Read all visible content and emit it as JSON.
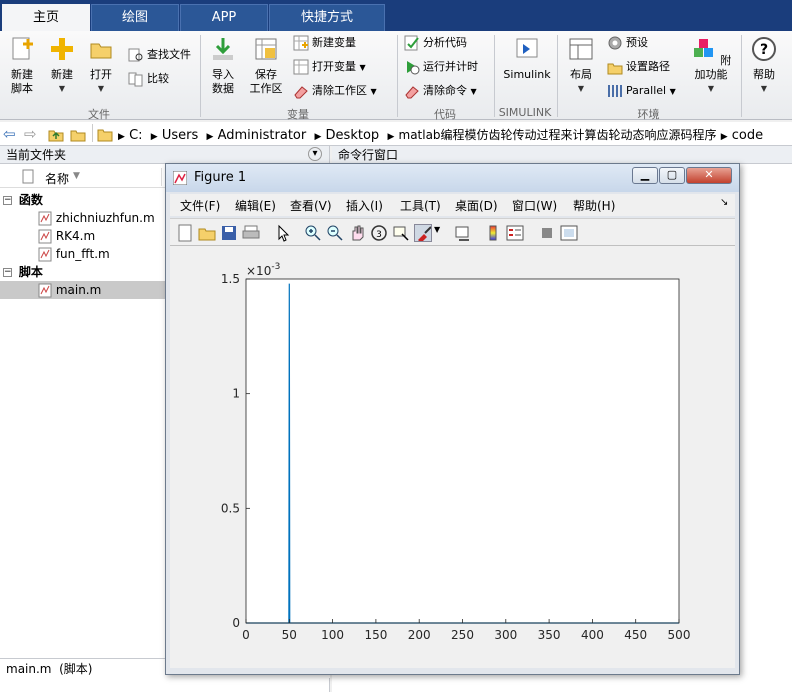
{
  "tabs": [
    {
      "label": "主页",
      "active": true
    },
    {
      "label": "绘图",
      "active": false
    },
    {
      "label": "APP",
      "active": false
    },
    {
      "label": "快捷方式",
      "active": false
    }
  ],
  "ribbon": {
    "file": {
      "new_script": "新建\n脚本",
      "new": "新建",
      "open": "打开",
      "find_files": "查找文件",
      "compare": "比较",
      "group": "文件"
    },
    "variable": {
      "import": "导入\n数据",
      "save_workspace": "保存\n工作区",
      "new_variable": "新建变量",
      "open_variable": "打开变量",
      "clear_workspace": "清除工作区",
      "group": "变量"
    },
    "code": {
      "analyze": "分析代码",
      "run_time": "运行并计时",
      "clear_commands": "清除命令",
      "group": "代码"
    },
    "simulink": {
      "label": "Simulink",
      "group": "SIMULINK"
    },
    "environment": {
      "layout": "布局",
      "preferences": "预设",
      "set_path": "设置路径",
      "parallel": "Parallel",
      "addons": "附加功能",
      "group": "环境"
    },
    "help": {
      "label": "帮助"
    }
  },
  "address": {
    "path": [
      "C:",
      "Users",
      "Administrator",
      "Desktop",
      "matlab编程模仿齿轮传动过程来计算齿轮动态响应源码程序",
      "code"
    ]
  },
  "current_folder": {
    "title": "当前文件夹",
    "column": "名称",
    "groups": [
      {
        "label": "函数",
        "files": [
          "zhichniuzhfun.m",
          "RK4.m",
          "fun_fft.m"
        ]
      },
      {
        "label": "脚本",
        "files": [
          "main.m"
        ]
      }
    ],
    "status": "main.m  (脚本)"
  },
  "command_window": {
    "title": "命令行窗口"
  },
  "figure": {
    "title": "Figure 1",
    "menus": [
      "文件(F)",
      "编辑(E)",
      "查看(V)",
      "插入(I)",
      "工具(T)",
      "桌面(D)",
      "窗口(W)",
      "帮助(H)"
    ]
  },
  "chart_data": {
    "type": "line",
    "exponent_label": "×10",
    "exponent_power": "-3",
    "xlim": [
      0,
      500
    ],
    "ylim": [
      0,
      0.0015
    ],
    "xticks": [
      "0",
      "50",
      "100",
      "150",
      "200",
      "250",
      "300",
      "350",
      "400",
      "450",
      "500"
    ],
    "yticks": [
      "0",
      "0.5",
      "1",
      "1.5"
    ],
    "ytick_values": [
      0,
      0.0005,
      0.001,
      0.0015
    ],
    "series": [
      {
        "color": "#0072bd",
        "x": [
          0,
          49.5,
          50,
          50.5,
          500
        ],
        "y": [
          0,
          0,
          0.00148,
          0,
          0
        ]
      }
    ],
    "grid": false
  },
  "colors": {
    "tabbar": "#1a3d7c",
    "series": "#0072bd"
  }
}
